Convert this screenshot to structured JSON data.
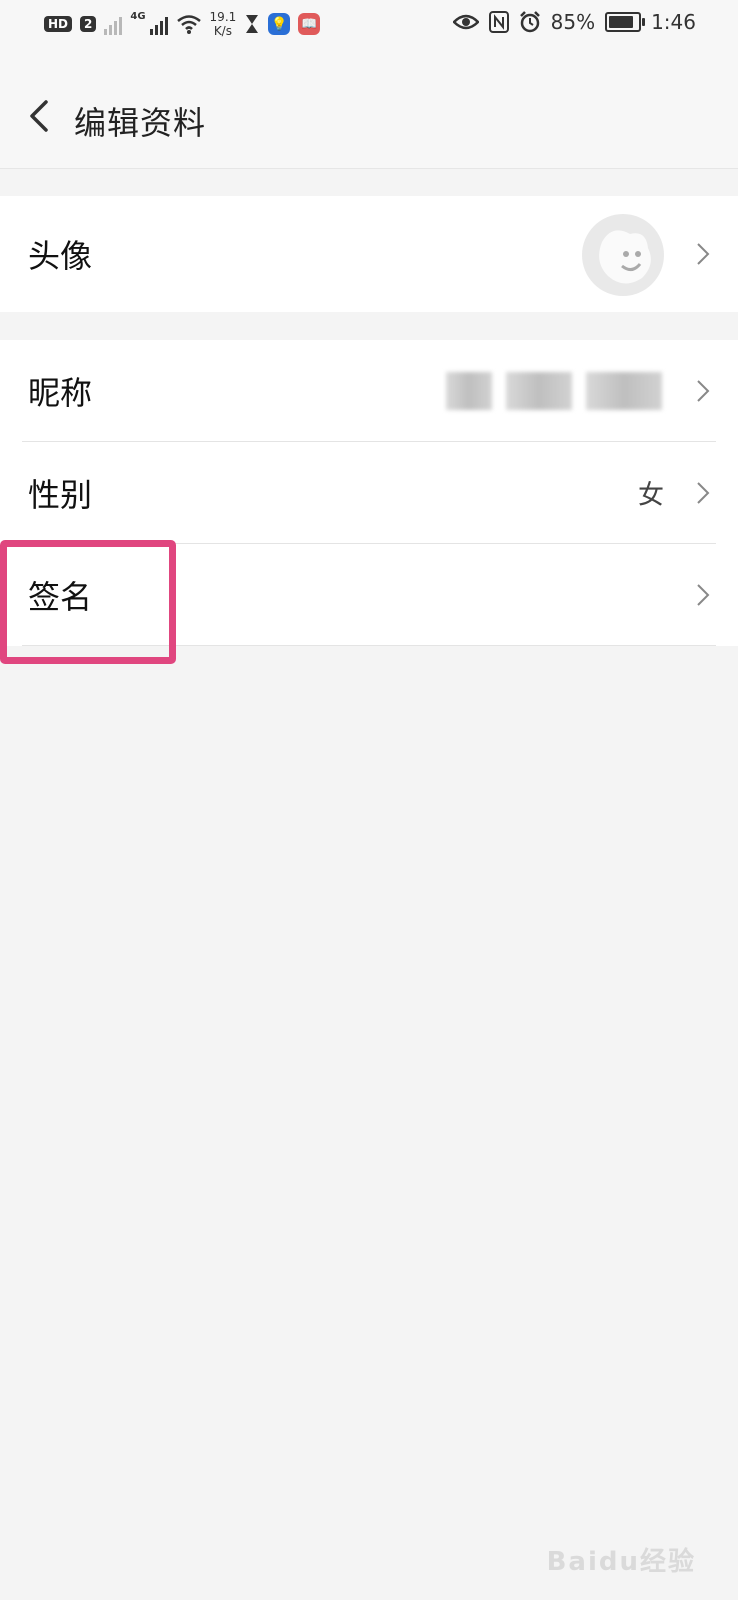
{
  "status_bar": {
    "hd": "HD",
    "sim2": "2",
    "net": "4G",
    "speed_value": "19.1",
    "speed_unit": "K/s",
    "battery": "85%",
    "time": "1:46",
    "icons": [
      "hourglass-icon",
      "lightbulb-icon",
      "book-icon",
      "eye-icon",
      "nfc-icon",
      "alarm-icon",
      "battery-icon"
    ]
  },
  "header": {
    "back_icon": "chevron-left-icon",
    "title": "编辑资料"
  },
  "avatar_section": {
    "label": "头像"
  },
  "profile_rows": [
    {
      "label": "昵称",
      "value": ""
    },
    {
      "label": "性别",
      "value": "女"
    },
    {
      "label": "签名",
      "value": ""
    }
  ],
  "highlight_color": "#e0467f",
  "watermark": "Baidu经验"
}
